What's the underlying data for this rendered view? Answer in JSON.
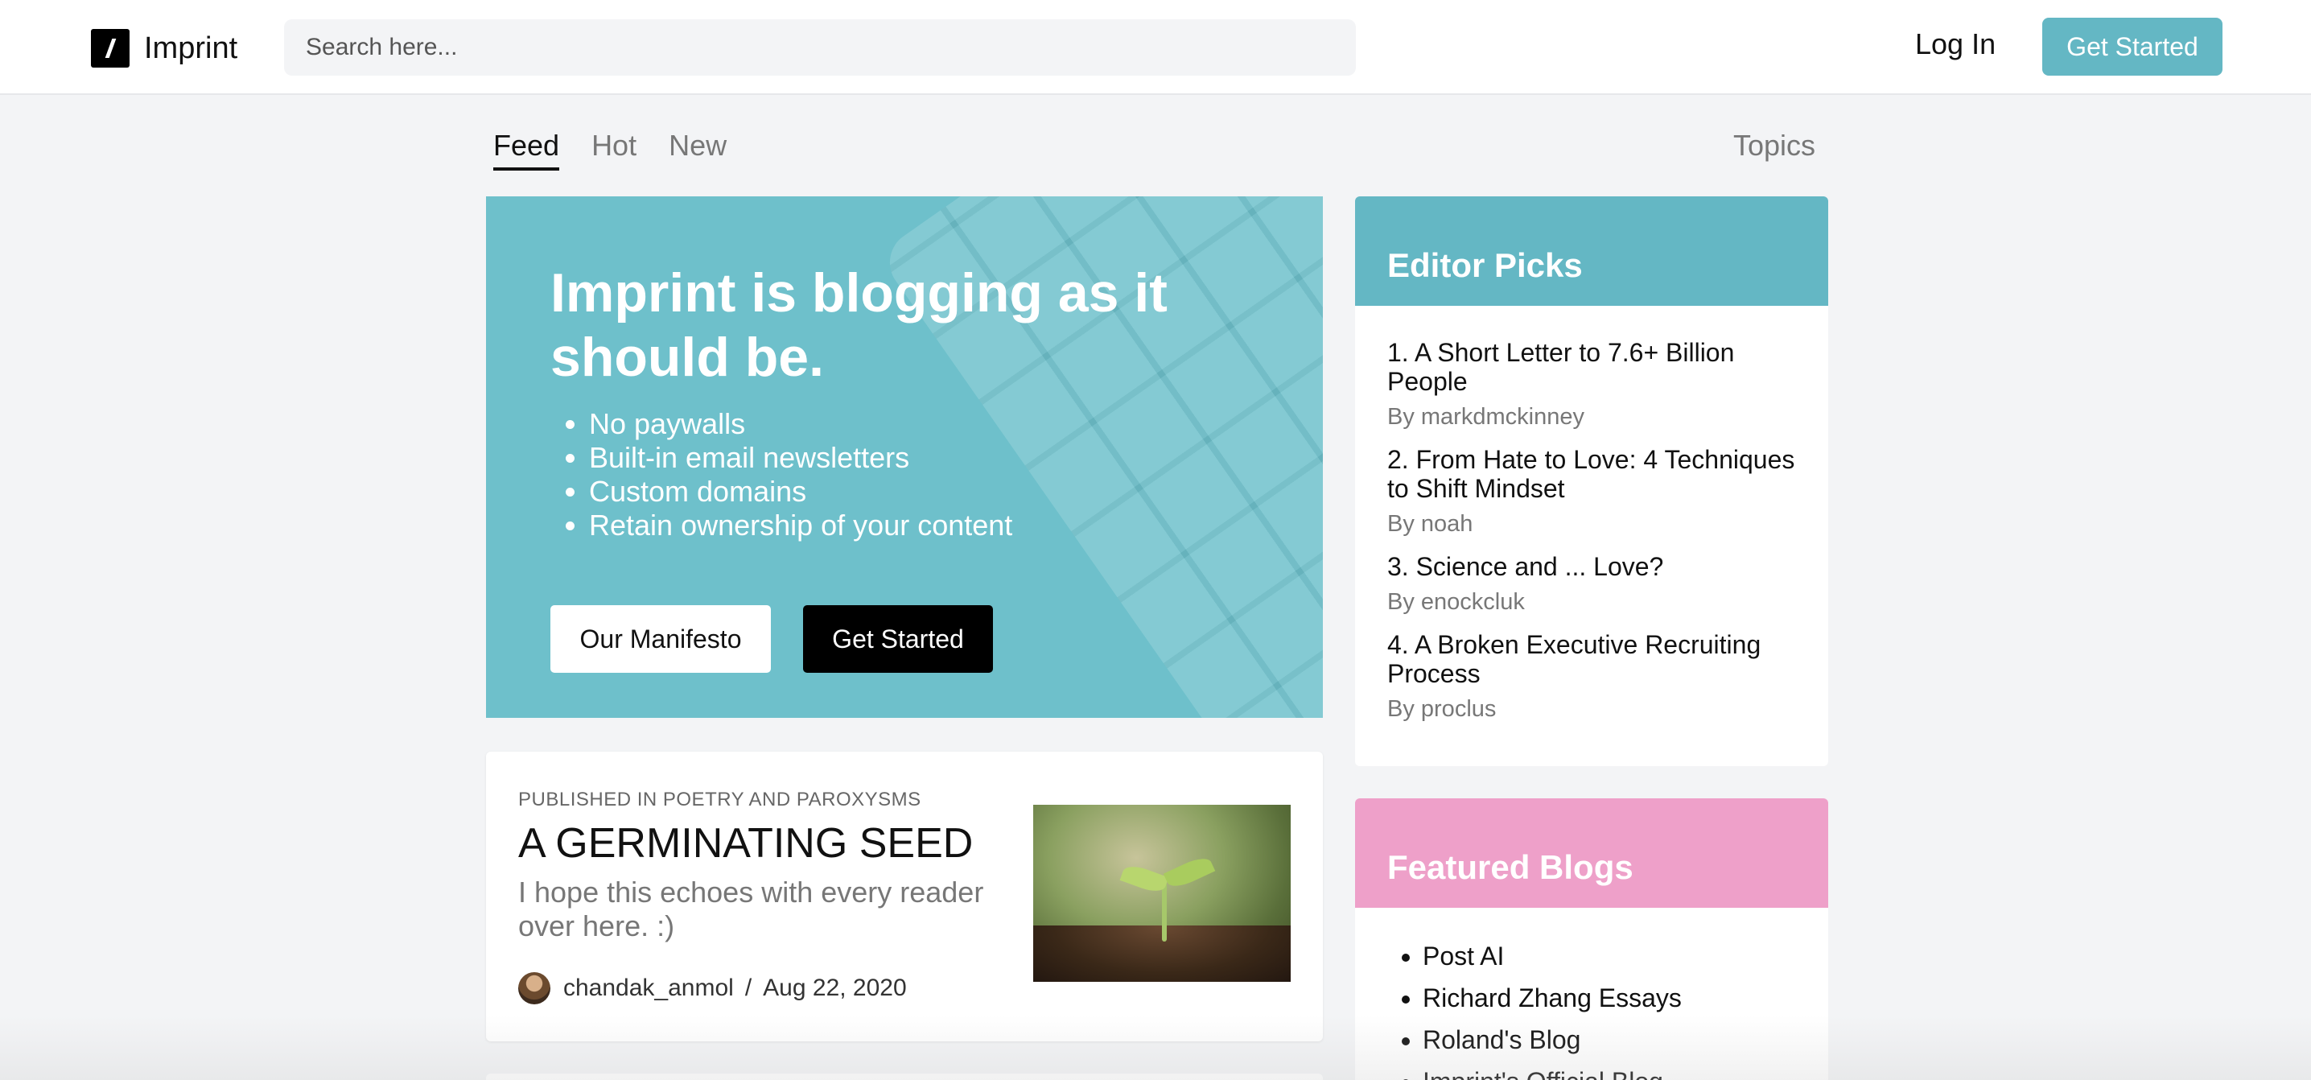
{
  "brand": {
    "name": "Imprint"
  },
  "search": {
    "placeholder": "Search here..."
  },
  "nav": {
    "login": "Log In",
    "get_started": "Get Started"
  },
  "tabs": [
    {
      "label": "Feed",
      "active": true
    },
    {
      "label": "Hot",
      "active": false
    },
    {
      "label": "New",
      "active": false
    }
  ],
  "topics": "Topics",
  "hero": {
    "title": "Imprint is blogging as it should be.",
    "features": [
      "No paywalls",
      "Built-in email newsletters",
      "Custom domains",
      "Retain ownership of your content"
    ],
    "manifesto_button": "Our Manifesto",
    "get_started_button": "Get Started",
    "background_color": "#6ec0cb"
  },
  "post": {
    "publication": "PUBLISHED IN POETRY AND PAROXYSMS",
    "title": "A GERMINATING SEED",
    "excerpt": "I hope this echoes with every reader over here. :)",
    "author": "chandak_anmol",
    "separator": "/",
    "date": "Aug 22, 2020"
  },
  "editor_picks": {
    "title": "Editor Picks",
    "items": [
      {
        "title": "1. A Short Letter to 7.6+ Billion People",
        "author": "By markdmckinney"
      },
      {
        "title": "2. From Hate to Love: 4 Techniques to Shift Mindset",
        "author": "By noah"
      },
      {
        "title": "3. Science and ... Love?",
        "author": "By enockcluk"
      },
      {
        "title": "4. A Broken Executive Recruiting Process",
        "author": "By proclus"
      }
    ]
  },
  "featured_blogs": {
    "title": "Featured Blogs",
    "items": [
      "Post AI",
      "Richard Zhang Essays",
      "Roland's Blog",
      "Imprint's Official Blog"
    ]
  },
  "colors": {
    "accent": "#64b7c4",
    "featured": "#eea0c9",
    "background": "#f3f4f6"
  }
}
